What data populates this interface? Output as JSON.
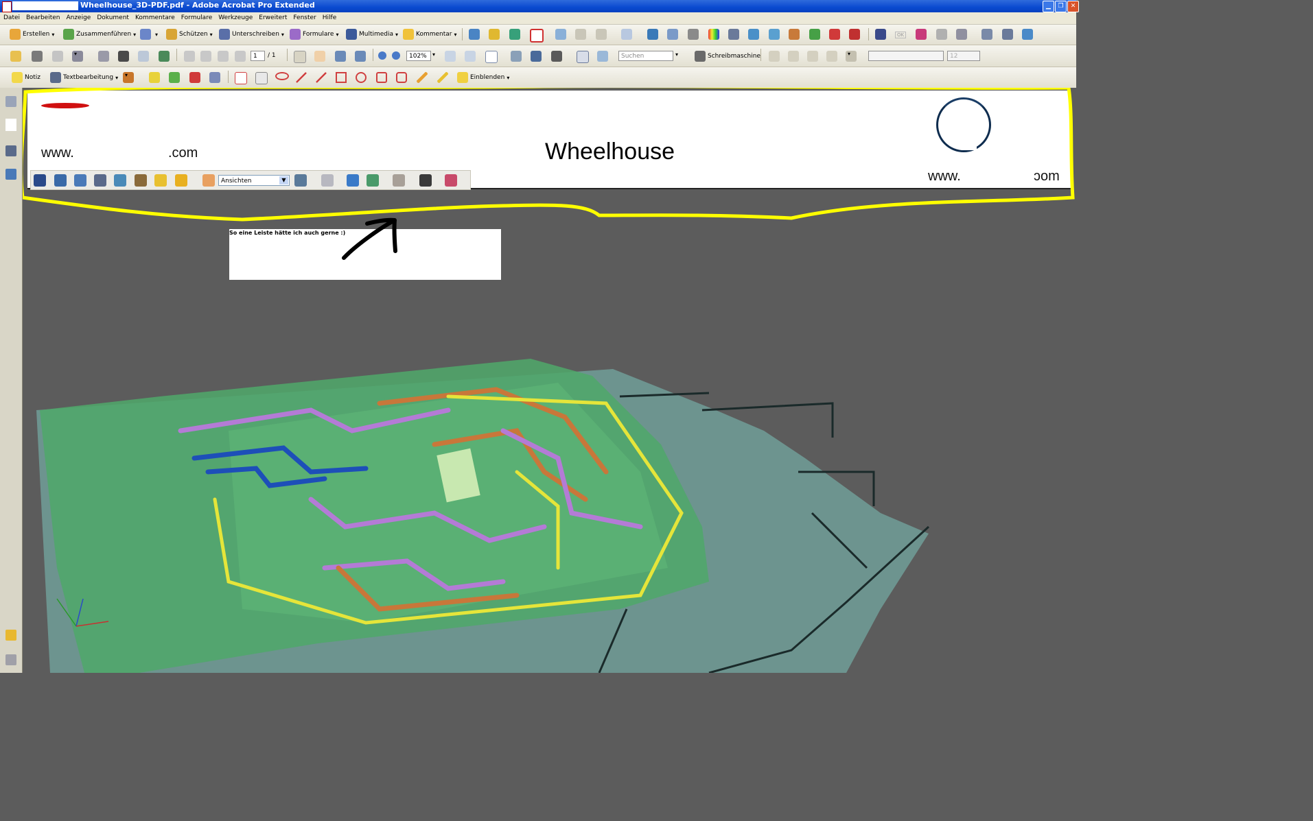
{
  "window": {
    "title": "Wheelhouse_3D-PDF.pdf - Adobe Acrobat Pro Extended"
  },
  "menu": [
    "Datei",
    "Bearbeiten",
    "Anzeige",
    "Dokument",
    "Kommentare",
    "Formulare",
    "Werkzeuge",
    "Erweitert",
    "Fenster",
    "Hilfe"
  ],
  "toolbar1": {
    "erstellen": "Erstellen",
    "zusammenfuehren": "Zusammenführen",
    "schuetzen": "Schützen",
    "unterschreiben": "Unterschreiben",
    "formulare": "Formulare",
    "multimedia": "Multimedia",
    "kommentar": "Kommentar",
    "ok_badge": "OK"
  },
  "toolbar2": {
    "page_current": "1",
    "page_total": "/ 1",
    "zoom": "102%",
    "search_placeholder": "Suchen",
    "typewriter": "Schreibmaschine",
    "font_size": "12"
  },
  "toolbar3": {
    "notiz": "Notiz",
    "textbearbeitung": "Textbearbeitung",
    "einblenden": "Einblenden"
  },
  "document": {
    "header": {
      "left_www": "www.",
      "left_com": ".com",
      "headline": "Wheelhouse",
      "right_www": "www.",
      "right_com": "ɔom"
    },
    "toolbar3d": {
      "views_select": "Ansichten"
    },
    "annotation": {
      "text": "So eine Leiste hätte ich auch gerne :)"
    }
  },
  "colors": {
    "highlight": "#ffff00",
    "arrow": "#000000",
    "hull_green": "#4fa86a",
    "pipe_purple": "#b47bd6",
    "pipe_orange": "#c8773a",
    "pipe_blue": "#1d4fb8",
    "deck_teal": "#6f9a95"
  }
}
